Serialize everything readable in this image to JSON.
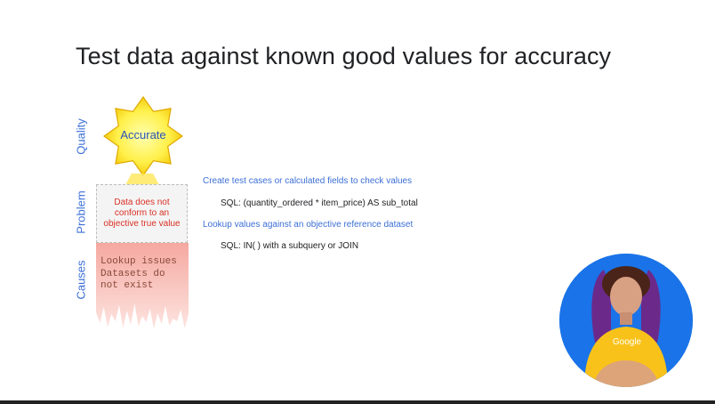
{
  "title": "Test data against known good values for accuracy",
  "labels": {
    "quality": "Quality",
    "problem": "Problem",
    "causes": "Causes"
  },
  "badge": {
    "label": "Accurate"
  },
  "problem_text": "Data does not\nconform to an\nobjective true value",
  "causes_text": "Lookup issues\nDatasets do\nnot exist",
  "notes": [
    "Create test cases or calculated fields to check values",
    "SQL: (quantity_ordered * item_price) AS sub_total",
    "Lookup values against an objective reference dataset",
    "SQL: IN( ) with a subquery or JOIN"
  ],
  "presenter": {
    "shirt_brand": "Google"
  },
  "colors": {
    "accent_blue": "#3c6fd6",
    "star_yellow": "#ffeb3b",
    "problem_red": "#d93025",
    "presenter_bg": "#1a73e8",
    "shirt_yellow": "#f9c21a"
  }
}
